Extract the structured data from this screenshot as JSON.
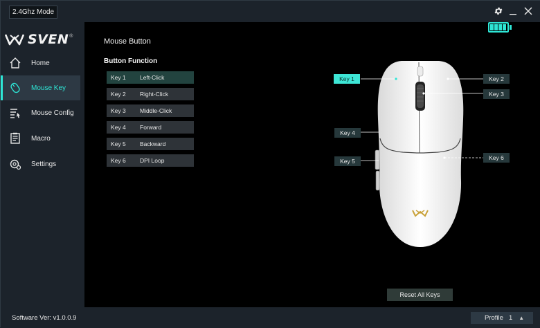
{
  "titlebar": {
    "mode": "2.4Ghz Mode",
    "settings_icon": "gear-icon",
    "minimize_icon": "minimize-icon",
    "close_icon": "close-icon"
  },
  "sidebar": {
    "logo": "SVEN",
    "logo_mark": "®",
    "items": [
      {
        "label": "Home",
        "icon": "home-icon"
      },
      {
        "label": "Mouse Key",
        "icon": "mouse-icon"
      },
      {
        "label": "Mouse Config",
        "icon": "config-icon"
      },
      {
        "label": "Macro",
        "icon": "macro-icon"
      },
      {
        "label": "Settings",
        "icon": "settings-icon"
      }
    ],
    "active_index": 1
  },
  "main": {
    "title": "Mouse Button",
    "section_title": "Button Function",
    "keys": [
      {
        "key": "Key 1",
        "function": "Left-Click"
      },
      {
        "key": "Key 2",
        "function": "Right-Click"
      },
      {
        "key": "Key 3",
        "function": "Middle-Click"
      },
      {
        "key": "Key 4",
        "function": "Forward"
      },
      {
        "key": "Key 5",
        "function": "Backward"
      },
      {
        "key": "Key 6",
        "function": "DPI Loop"
      }
    ],
    "selected_key": "Key 1",
    "battery_level": 1.0,
    "mouse_labels": [
      "Key 1",
      "Key 2",
      "Key 3",
      "Key 4",
      "Key 5",
      "Key 6"
    ],
    "reset_label": "Reset All Keys"
  },
  "footer": {
    "version": "Software Ver: v1.0.0.9",
    "profile_label": "Profile",
    "profile_number": "1"
  },
  "colors": {
    "accent": "#2ee6d6",
    "background": "#1c232b",
    "panel": "#000000"
  }
}
